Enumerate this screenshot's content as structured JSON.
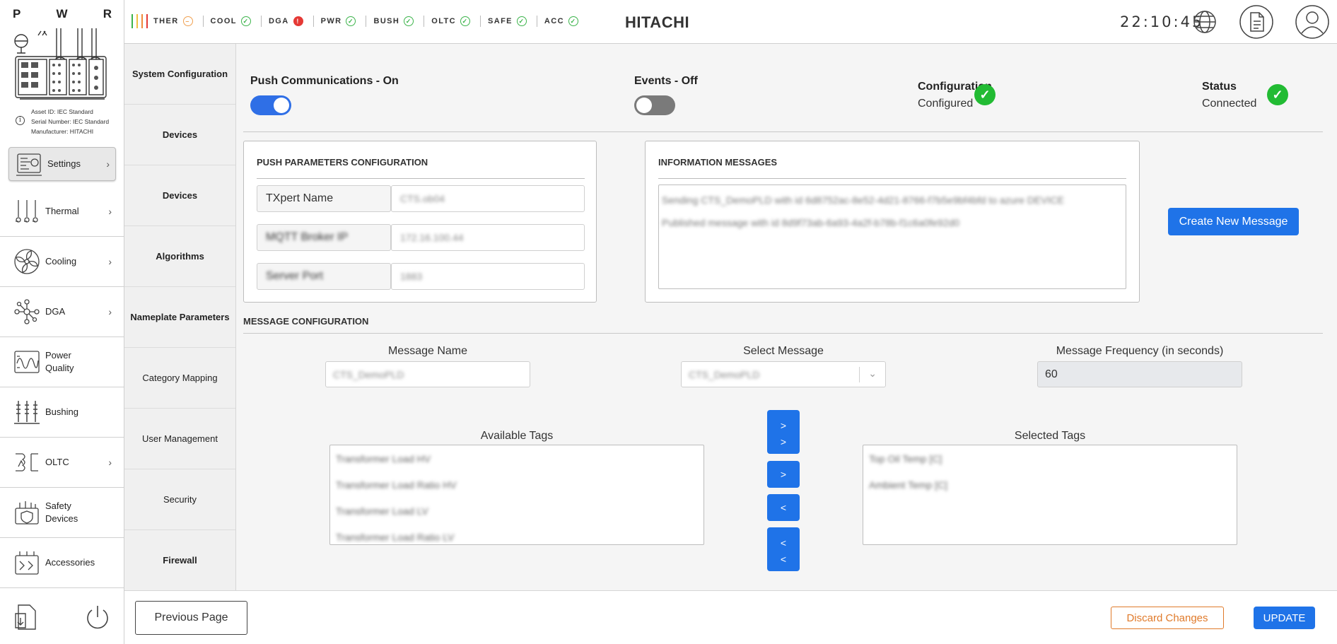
{
  "sidebar": {
    "letters": [
      "P",
      "W",
      "R"
    ],
    "asset_info": {
      "asset_id": "Asset ID: IEC Standard",
      "serial": "Serial Number: IEC Standard",
      "manufacturer": "Manufacturer: HITACHI"
    },
    "items": [
      {
        "label": "Settings",
        "icon": "settings-icon",
        "has_chevron": true,
        "active": true
      },
      {
        "label": "Thermal",
        "icon": "thermometer-icon",
        "has_chevron": true
      },
      {
        "label": "Cooling",
        "icon": "fan-icon",
        "has_chevron": true
      },
      {
        "label": "DGA",
        "icon": "molecule-icon",
        "has_chevron": true
      },
      {
        "label": "Power Quality",
        "icon": "waveform-icon",
        "has_chevron": false
      },
      {
        "label": "Bushing",
        "icon": "bushing-icon",
        "has_chevron": false
      },
      {
        "label": "OLTC",
        "icon": "tap-changer-icon",
        "has_chevron": true
      },
      {
        "label": "Safety Devices",
        "icon": "safety-device-icon",
        "has_chevron": false
      },
      {
        "label": "Accessories",
        "icon": "accessories-icon",
        "has_chevron": false
      }
    ]
  },
  "topbar": {
    "status": [
      {
        "label": "THER",
        "state": "warning",
        "glyph": "–"
      },
      {
        "label": "COOL",
        "state": "ok",
        "glyph": "✓"
      },
      {
        "label": "DGA",
        "state": "alarm",
        "glyph": "!"
      },
      {
        "label": "PWR",
        "state": "ok",
        "glyph": "✓"
      },
      {
        "label": "BUSH",
        "state": "ok",
        "glyph": "✓"
      },
      {
        "label": "OLTC",
        "state": "ok",
        "glyph": "✓"
      },
      {
        "label": "SAFE",
        "state": "ok",
        "glyph": "✓"
      },
      {
        "label": "ACC",
        "state": "ok",
        "glyph": "✓"
      }
    ],
    "brand": "HITACHI",
    "time": "22:10:45"
  },
  "subnav": {
    "items": [
      {
        "label": "System Configuration",
        "bold": true
      },
      {
        "label": "Devices",
        "bold": true
      },
      {
        "label": "Devices",
        "bold": true
      },
      {
        "label": "Algorithms",
        "bold": true
      },
      {
        "label": "Nameplate Parameters",
        "bold": true
      },
      {
        "label": "Category Mapping",
        "bold": false
      },
      {
        "label": "User Management",
        "bold": false
      },
      {
        "label": "Security",
        "bold": false
      },
      {
        "label": "Firewall",
        "bold": true
      }
    ]
  },
  "main": {
    "push_comms": {
      "label": "Push Communications - On",
      "on": true
    },
    "events": {
      "label": "Events - Off",
      "on": false
    },
    "configuration": {
      "label": "Configuration",
      "value": "Configured"
    },
    "status": {
      "label": "Status",
      "value": "Connected"
    },
    "push_params": {
      "title": "PUSH PARAMETERS CONFIGURATION",
      "rows": [
        {
          "key": "TXpert Name",
          "value": "CTS.ob04",
          "key_blurred": false
        },
        {
          "key": "MQTT Broker IP",
          "value": "172.16.100.44",
          "key_blurred": true
        },
        {
          "key": "Server Port",
          "value": "1883",
          "key_blurred": true
        }
      ]
    },
    "info_messages": {
      "title": "INFORMATION MESSAGES",
      "lines": [
        "Sending CTS_DemoPLD with id 6d8752ac-8e52-4d21-8766-f7b5e9bf4bfd to azure DEVICE",
        "Published message with id 8d9f73ab-6a93-4a2f-b78b-f1c6a0fe92d0"
      ]
    },
    "create_button": "Create New Message",
    "message_config": {
      "title": "MESSAGE CONFIGURATION",
      "name_label": "Message Name",
      "name_value": "CTS_DemoPLD",
      "select_label": "Select Message",
      "select_value": "CTS_DemoPLD",
      "freq_label": "Message Frequency (in seconds)",
      "freq_value": "60"
    },
    "available_tags": {
      "label": "Available Tags",
      "items": [
        "Transformer Load HV",
        "Transformer Load Ratio HV",
        "Transformer Load LV",
        "Transformer Load Ratio LV"
      ]
    },
    "selected_tags": {
      "label": "Selected Tags",
      "items": [
        "Top Oil Temp [C]",
        "Ambient Temp [C]"
      ]
    },
    "transfer": {
      "add_all": ">\n>",
      "add": ">",
      "remove": "<",
      "remove_all": "<\n<"
    }
  },
  "footer": {
    "previous": "Previous Page",
    "discard": "Discard Changes",
    "update": "UPDATE"
  },
  "colors": {
    "accent_blue": "#1f73e8",
    "ok_green": "#22bb33",
    "alarm_red": "#e53935",
    "warn_orange": "#f0a050",
    "discard_orange": "#e07a2a"
  }
}
